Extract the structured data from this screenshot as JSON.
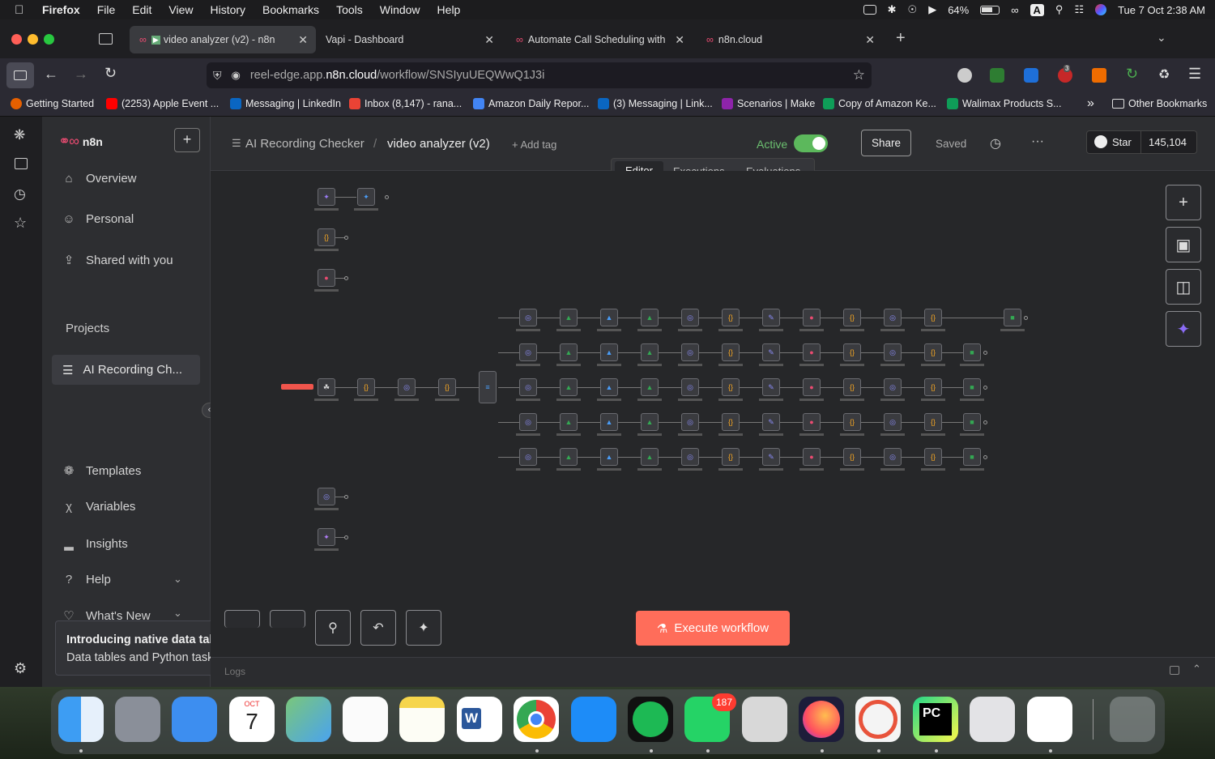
{
  "menubar": {
    "items": [
      "Firefox",
      "File",
      "Edit",
      "View",
      "History",
      "Bookmarks",
      "Tools",
      "Window",
      "Help"
    ],
    "battery": "64%",
    "input_source": "A",
    "datetime": "Tue 7 Oct  2:38 AM"
  },
  "tabs": [
    {
      "label": "video analyzer (v2) - n8n",
      "active": true
    },
    {
      "label": "Vapi - Dashboard",
      "active": false
    },
    {
      "label": "Automate Call Scheduling with \\",
      "active": false
    },
    {
      "label": "n8n.cloud",
      "active": false
    }
  ],
  "url": {
    "prefix": "reel-edge.app.",
    "domain": "n8n.cloud",
    "path": "/workflow/SNSIyuUEQWwQ1J3i"
  },
  "extensions_badge": "3",
  "bookmarks": [
    "Getting Started",
    "(2253) Apple Event ...",
    "Messaging | LinkedIn",
    "Inbox (8,147) - rana...",
    "Amazon Daily Repor...",
    "(3) Messaging | Link...",
    "Scenarios | Make",
    "Copy of Amazon Ke...",
    "Walimax Products S...",
    "Other Bookmarks"
  ],
  "sidebar": {
    "brand": "n8n",
    "nav": [
      "Overview",
      "Personal",
      "Shared with you"
    ],
    "projects_heading": "Projects",
    "project_item": "AI Recording Ch...",
    "bottom_nav": [
      "Templates",
      "Variables",
      "Insights",
      "Help",
      "What's New"
    ]
  },
  "toast": {
    "title": "Introducing native data tables",
    "body": "Data tables and Python task runner"
  },
  "header": {
    "project": "AI Recording Checker",
    "separator": "/",
    "workflow_name": "video analyzer (v2)",
    "add_tag": "+ Add tag",
    "active_label": "Active",
    "share_label": "Share",
    "saved_label": "Saved",
    "star_label": "Star",
    "star_count": "145,104"
  },
  "view_tabs": [
    "Editor",
    "Executions",
    "Evaluations"
  ],
  "execute_label": "Execute workflow",
  "bottom_panel_label": "Logs",
  "colors": {
    "accent": "#ea4b71",
    "execute": "#ff6d5a",
    "toggle": "#5cb85c"
  }
}
